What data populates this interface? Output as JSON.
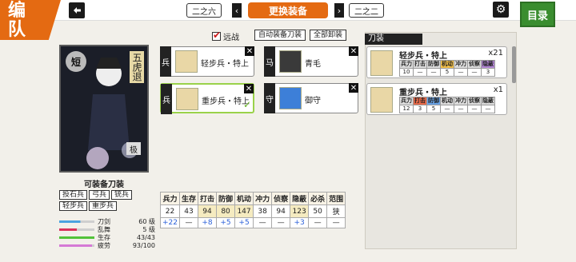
{
  "header": {
    "tab_line1": "编",
    "tab_line2": "队",
    "back_icon": "back-arrow-icon",
    "prev_page_label": "二之六",
    "title": "更换装备",
    "next_page_label": "二之二",
    "menu_label": "目录",
    "settings_icon": "gear-icon"
  },
  "sword": {
    "type_badge": "短",
    "name": "五虎退",
    "rank_badge": "极"
  },
  "equip": {
    "label": "可装备刀装",
    "troop_types": [
      "投石兵",
      "弓兵",
      "铳兵",
      "轻步兵",
      "重步兵"
    ],
    "stats": [
      {
        "label": "刀剑",
        "value": "60 级",
        "fill_pct": 60,
        "color": "#4aa3e0"
      },
      {
        "label": "乱舞",
        "value": "5 级",
        "fill_pct": 50,
        "color": "#d9335c"
      },
      {
        "label": "生存",
        "value": "43/43",
        "fill_pct": 100,
        "color": "#52c23a"
      },
      {
        "label": "疲劳",
        "value": "93/100",
        "fill_pct": 93,
        "color": "#d57ad6"
      }
    ]
  },
  "controls": {
    "dual_label": "远战",
    "auto_equip": "自动装备刀装",
    "unequip_all": "全部卸装"
  },
  "slots": [
    {
      "tag": "兵",
      "name": "轻步兵・特上",
      "selected": false
    },
    {
      "tag": "兵",
      "name": "重步兵・特上",
      "selected": true
    },
    {
      "tag": "马",
      "name": "青毛",
      "selected": false
    },
    {
      "tag": "守",
      "name": "御守",
      "selected": false
    }
  ],
  "stats_table": {
    "headers": [
      "兵力",
      "生存",
      "打击",
      "防御",
      "机动",
      "冲力",
      "侦察",
      "隐蔽",
      "必杀",
      "范围"
    ],
    "base": [
      "22",
      "43",
      "94",
      "80",
      "147",
      "38",
      "94",
      "123",
      "50",
      "狭"
    ],
    "bonus": [
      "+22",
      "—",
      "+8",
      "+5",
      "+5",
      "—",
      "—",
      "+3",
      "—",
      "—"
    ]
  },
  "inventory": {
    "title": "刀装",
    "items": [
      {
        "name": "轻步兵・特上",
        "count": "x21",
        "headers": [
          "兵力",
          "打击",
          "防御",
          "机动",
          "冲力",
          "侦察",
          "隐蔽"
        ],
        "values": [
          "10",
          "—",
          "—",
          "5",
          "—",
          "—",
          "3"
        ]
      },
      {
        "name": "重步兵・特上",
        "count": "x1",
        "headers": [
          "兵力",
          "打击",
          "防御",
          "机动",
          "冲力",
          "侦察",
          "隐蔽"
        ],
        "values": [
          "12",
          "3",
          "5",
          "—",
          "—",
          "—",
          "—"
        ]
      }
    ]
  }
}
